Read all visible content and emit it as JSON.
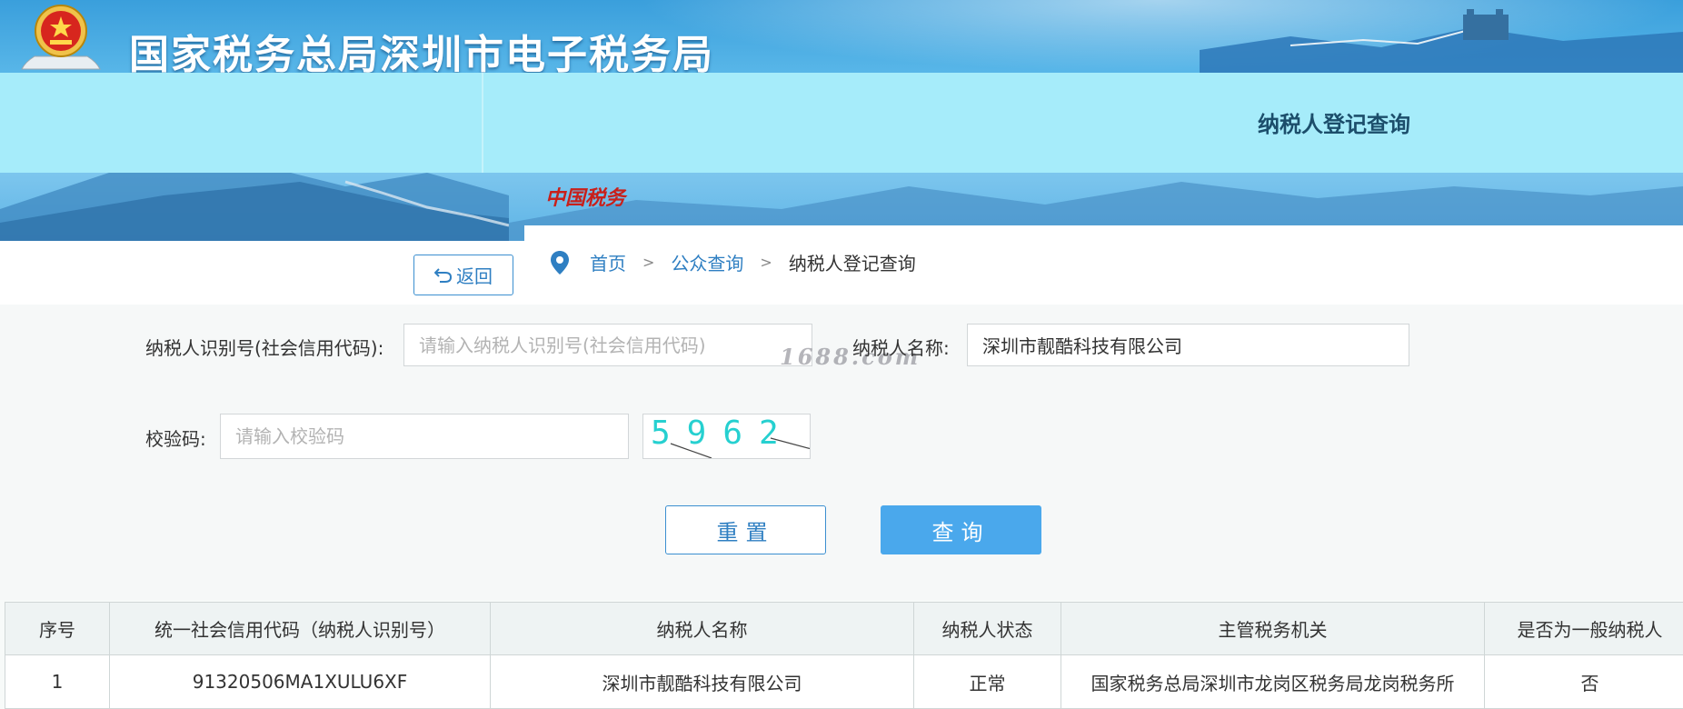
{
  "header": {
    "site_title": "国家税务总局深圳市电子税务局",
    "page_hint": "纳税人登记查询",
    "logo_text": "中国税务"
  },
  "nav": {
    "back_label": "返回",
    "breadcrumb": [
      "首页",
      "公众查询",
      "纳税人登记查询"
    ],
    "separator": ">"
  },
  "form": {
    "taxpayer_id_label": "纳税人识别号(社会信用代码):",
    "taxpayer_id_placeholder": "请输入纳税人识别号(社会信用代码)",
    "taxpayer_id_value": "",
    "taxpayer_name_label": "纳税人名称:",
    "taxpayer_name_value": "深圳市靓酷科技有限公司",
    "captcha_label": "校验码:",
    "captcha_placeholder": "请输入校验码",
    "captcha_value": "",
    "captcha_image_text": "5962",
    "reset_label": "重置",
    "query_label": "查询",
    "watermark": "1688.com"
  },
  "results": {
    "columns": [
      "序号",
      "统一社会信用代码（纳税人识别号）",
      "纳税人名称",
      "纳税人状态",
      "主管税务机关",
      "是否为一般纳税人"
    ],
    "rows": [
      [
        "1",
        "91320506MA1XULU6XF",
        "深圳市靓酷科技有限公司",
        "正常",
        "国家税务总局深圳市龙岗区税务局龙岗税务所",
        "否"
      ]
    ]
  },
  "colors": {
    "accent": "#2f7fc2",
    "query_button": "#4aa8ec",
    "banner_sky": "#58b6e8",
    "hint_band": "#a6ecfa",
    "captcha_digits": "#26d0d0"
  },
  "icons": {
    "emblem": "national-tax-emblem",
    "back": "undo-arrow-icon",
    "location": "map-pin-icon"
  }
}
